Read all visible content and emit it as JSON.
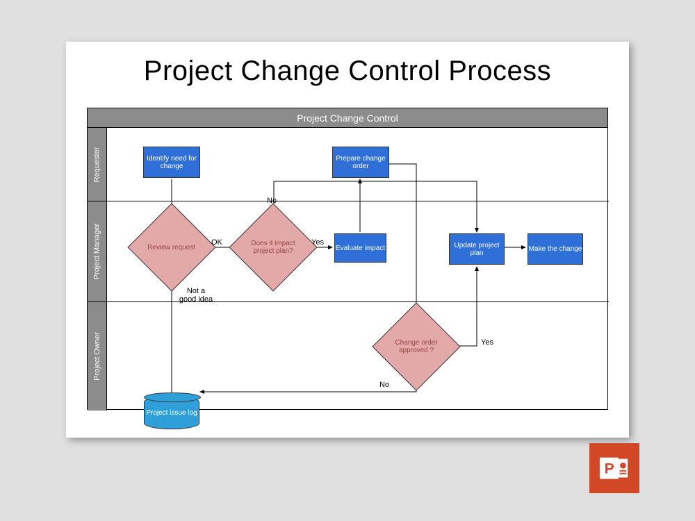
{
  "title": "Project Change Control Process",
  "frame_header": "Project Change Control",
  "lanes": {
    "requester": "Requester",
    "project_manager": "Project Manager",
    "project_owner": "Project Owner"
  },
  "nodes": {
    "identify": "Identify need for change",
    "prepare": "Prepare change order",
    "review": "Review request",
    "impact_q": "Does it impact project plan?",
    "evaluate": "Evaluate impact",
    "update": "Update project plan",
    "make": "Make the change",
    "approved_q": "Change order approved ?",
    "issue_log": "Project issue log"
  },
  "edges": {
    "ok": "OK",
    "no": "No",
    "yes": "Yes",
    "not_good": "Not a good idea",
    "yes2": "Yes",
    "no2": "No"
  },
  "badge": {
    "app": "PowerPoint"
  }
}
